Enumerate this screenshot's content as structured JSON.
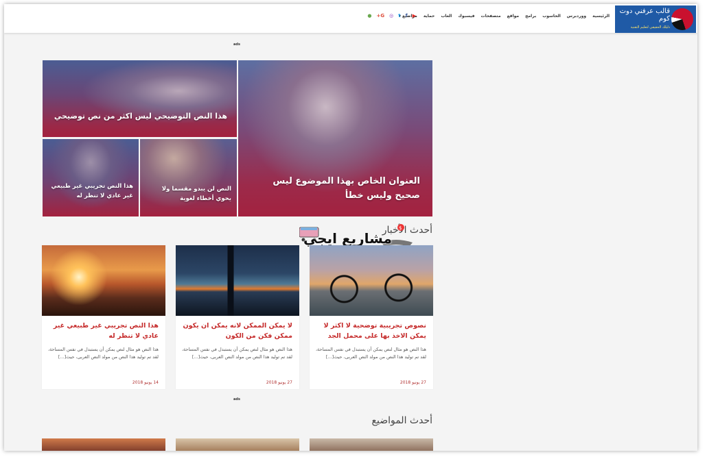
{
  "header": {
    "logo_title": "قالب عرفني دوت كوم",
    "logo_tagline": "دليلك الحقيقي لتعليم التقنية",
    "nav": [
      "الرئيسية",
      "ووردبرس",
      "الحاسوب",
      "برامج",
      "مواقع",
      "متصفحات",
      "فيسبوك",
      "العاب",
      "حماية",
      "مواضيع"
    ],
    "social": [
      {
        "icon": "youtube-icon",
        "glyph": "▶",
        "color": "#e52d27"
      },
      {
        "icon": "facebook-icon",
        "glyph": "f",
        "color": "#3b5998"
      },
      {
        "icon": "twitter-icon",
        "glyph": "t",
        "color": "#1da1f2"
      },
      {
        "icon": "instagram-icon",
        "glyph": "◎",
        "color": "#8a3ab9"
      },
      {
        "icon": "google-plus-icon",
        "glyph": "G+",
        "color": "#dd4b39"
      },
      {
        "icon": "rss-icon",
        "glyph": "●",
        "color": "#6aa84f"
      }
    ]
  },
  "ads_label": "ads",
  "hero": {
    "main_title": "العنوان الخاص بهذا الموضوع ليس صحيح وليس خطأ",
    "top_title": "هذا النص التوضيحي ليس اكثر من نص توضيحي",
    "small_1_title": "النص لن يبدو مقسما ولا يحوي أخطاء لغوية",
    "small_2_title": "هذا النص تجريبي غير طبيعي غير عادي لا تنظر له"
  },
  "latest_news": {
    "heading": "أحدث الأخبار",
    "cards": [
      {
        "title": "نصوص تجريبية توضحية لا اكثر لا يمكن الاخذ بها على محمل الجد",
        "excerpt": "هذا النص هو مثال لنص يمكن أن يستبدل في نفس المساحة، لقد تم توليد هذا النص من مولد النص العربى، حيث[...]",
        "date": "27 يونيو 2018",
        "thumb": "bike"
      },
      {
        "title": "لا يمكن الممكن لانه يمكن ان يكون ممكن فكن من الكون",
        "excerpt": "هذا النص هو مثال لنص يمكن أن يستبدل في نفس المساحة، لقد تم توليد هذا النص من مولد النص العربى، حيث[...]",
        "date": "27 يونيو 2018",
        "thumb": "night"
      },
      {
        "title": "هذا النص تجريبي غير طبيعي غير عادي لا تنظر له",
        "excerpt": "هذا النص هو مثال لنص يمكن أن يستبدل في نفس المساحة، لقد تم توليد هذا النص من مولد النص العربى، حيث[...]",
        "date": "14 يونيو 2018",
        "thumb": "sunset"
      }
    ]
  },
  "latest_topics": {
    "heading": "أحدث المواضيع"
  },
  "watermark": "مشاريع ايجي",
  "colors": {
    "accent": "#c52a2a",
    "logo_bg": "#1f5aa6"
  }
}
